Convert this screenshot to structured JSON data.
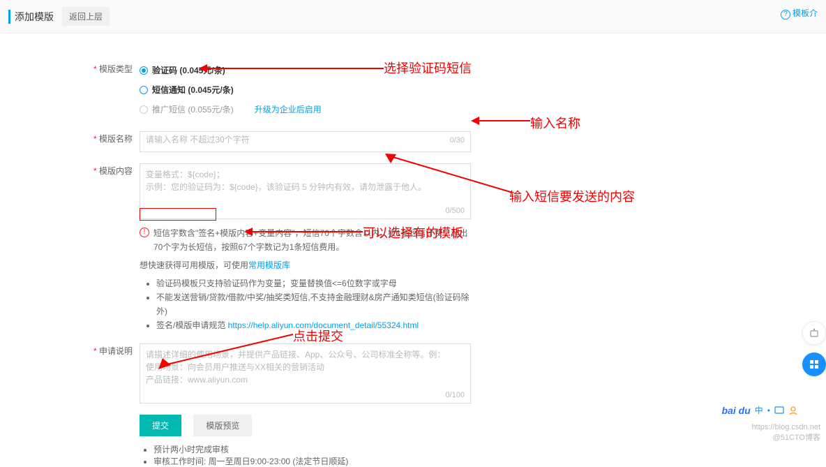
{
  "header": {
    "title": "添加模版",
    "back": "返回上层",
    "help": "模板介"
  },
  "form": {
    "type": {
      "label": "模版类型",
      "options": [
        {
          "name": "验证码 (0.045元/条)",
          "checked": true
        },
        {
          "name": "短信通知 (0.045元/条)",
          "checked": false
        },
        {
          "name": "推广短信 (0.055元/条)",
          "checked": false,
          "hint": "升级为企业后启用"
        }
      ]
    },
    "name": {
      "label": "模版名称",
      "placeholder": "请输入名称 不超过30个字符",
      "counter": "0/30"
    },
    "content": {
      "label": "模版内容",
      "line1": "变量格式：${code}；",
      "line2": "示例：您的验证码为：${code}，该验证码 5 分钟内有效，请勿泄露于他人。",
      "counter": "0/500",
      "warn": "短信字数含\"签名+模版内容+变量内容\"，短信70个字数含以内，按1条短信计费；超出70个字为长短信，按照67个字数记为1条短信费用。",
      "quick_prefix": "想快速获得可用模版，可使用",
      "quick_link": "常用模版库",
      "bullets": [
        "验证码模板只支持验证码作为变量；变量替换值<=6位数字或字母",
        "不能发送营销/贷款/借款/中奖/抽奖类短信,不支持金融理财&房产通知类短信(验证码除外)",
        "签名/模版申请规范 https://help.aliyun.com/document_detail/55324.html"
      ],
      "doc_link": "https://help.aliyun.com/document_detail/55324.html"
    },
    "desc": {
      "label": "申请说明",
      "placeholder1": "请描述详细的使用场景，并提供产品链接、App、公众号、公司标准全称等。例：",
      "placeholder2": "使用场景：向会员用户推送与XX相关的营销活动",
      "placeholder3": "产品链接：www.aliyun.com",
      "counter": "0/100"
    },
    "submit": "提交",
    "preview": "模版预览",
    "notes": [
      "预计两小时完成审核",
      "审核工作时间: 周一至周日9:00-23:00 (法定节日顺延)"
    ]
  },
  "annotations": {
    "a1": "选择验证码短信",
    "a2": "输入名称",
    "a3": "输入短信要发送的内容",
    "a4": "可以选择有的模板",
    "a5": "点击提交"
  },
  "footer": {
    "brand": "bai du",
    "zhong": "中",
    "watermark2": "@51CTO博客",
    "watermark1": "https://blog.csdn.net"
  }
}
